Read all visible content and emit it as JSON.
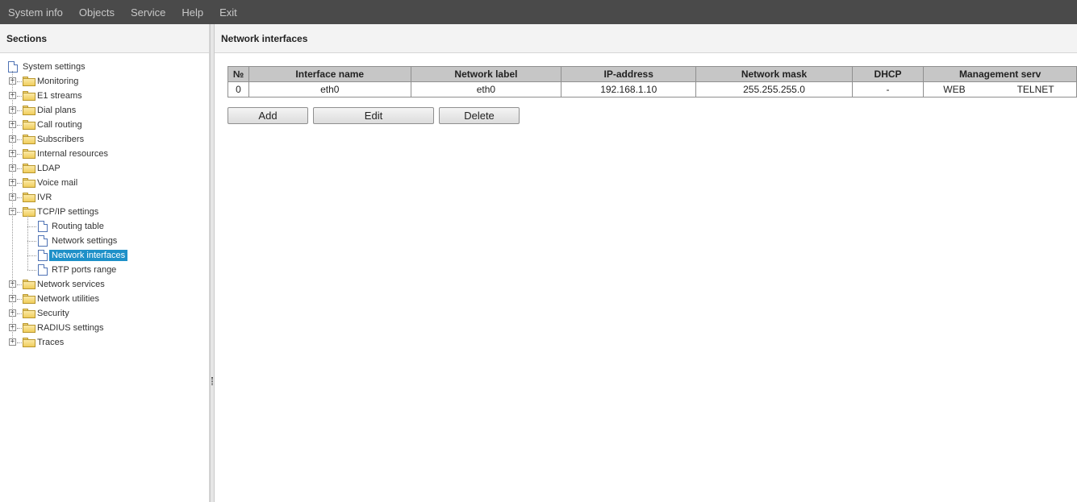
{
  "menu": {
    "items": [
      {
        "label": "System info"
      },
      {
        "label": "Objects"
      },
      {
        "label": "Service"
      },
      {
        "label": "Help"
      },
      {
        "label": "Exit"
      }
    ]
  },
  "sidebar": {
    "title": "Sections",
    "root_label": "System settings",
    "items": [
      {
        "label": "Monitoring",
        "icon": "folder-icon",
        "expander": "+"
      },
      {
        "label": "E1 streams",
        "icon": "folder-icon",
        "expander": "+"
      },
      {
        "label": "Dial plans",
        "icon": "folder-icon",
        "expander": "+"
      },
      {
        "label": "Call routing",
        "icon": "folder-icon",
        "expander": "+"
      },
      {
        "label": "Subscribers",
        "icon": "folder-icon",
        "expander": "+"
      },
      {
        "label": "Internal resources",
        "icon": "folder-icon",
        "expander": "+"
      },
      {
        "label": "LDAP",
        "icon": "folder-icon",
        "expander": "+"
      },
      {
        "label": "Voice mail",
        "icon": "folder-icon",
        "expander": "+"
      },
      {
        "label": "IVR",
        "icon": "folder-icon",
        "expander": "+"
      },
      {
        "label": "TCP/IP settings",
        "icon": "folder-icon",
        "expander": "−"
      },
      {
        "label": "Network services",
        "icon": "folder-icon",
        "expander": "+"
      },
      {
        "label": "Network utilities",
        "icon": "folder-icon",
        "expander": "+"
      },
      {
        "label": "Security",
        "icon": "folder-icon",
        "expander": "+"
      },
      {
        "label": "RADIUS settings",
        "icon": "folder-icon",
        "expander": "+"
      },
      {
        "label": "Traces",
        "icon": "folder-icon",
        "expander": "+"
      }
    ],
    "tcpip_children": [
      {
        "label": "Routing table",
        "icon": "document-icon"
      },
      {
        "label": "Network settings",
        "icon": "document-icon"
      },
      {
        "label": "Network interfaces",
        "icon": "document-icon",
        "selected": true
      },
      {
        "label": "RTP ports range",
        "icon": "document-icon"
      }
    ]
  },
  "main": {
    "title": "Network interfaces",
    "table": {
      "headers": [
        "№",
        "Interface name",
        "Network label",
        "IP-address",
        "Network mask",
        "DHCP",
        "Management serv"
      ],
      "rows": [
        {
          "no": "0",
          "interface_name": "eth0",
          "network_label": "eth0",
          "ip_address": "192.168.1.10",
          "network_mask": "255.255.255.0",
          "dhcp": "-",
          "mgmt_web": "WEB",
          "mgmt_telnet": "TELNET"
        }
      ]
    },
    "buttons": {
      "add": "Add",
      "edit": "Edit",
      "delete": "Delete"
    }
  },
  "colors": {
    "menubar_bg": "#4a4a4a",
    "selection": "#1e90c8",
    "header_bg": "#c6c6c6"
  }
}
